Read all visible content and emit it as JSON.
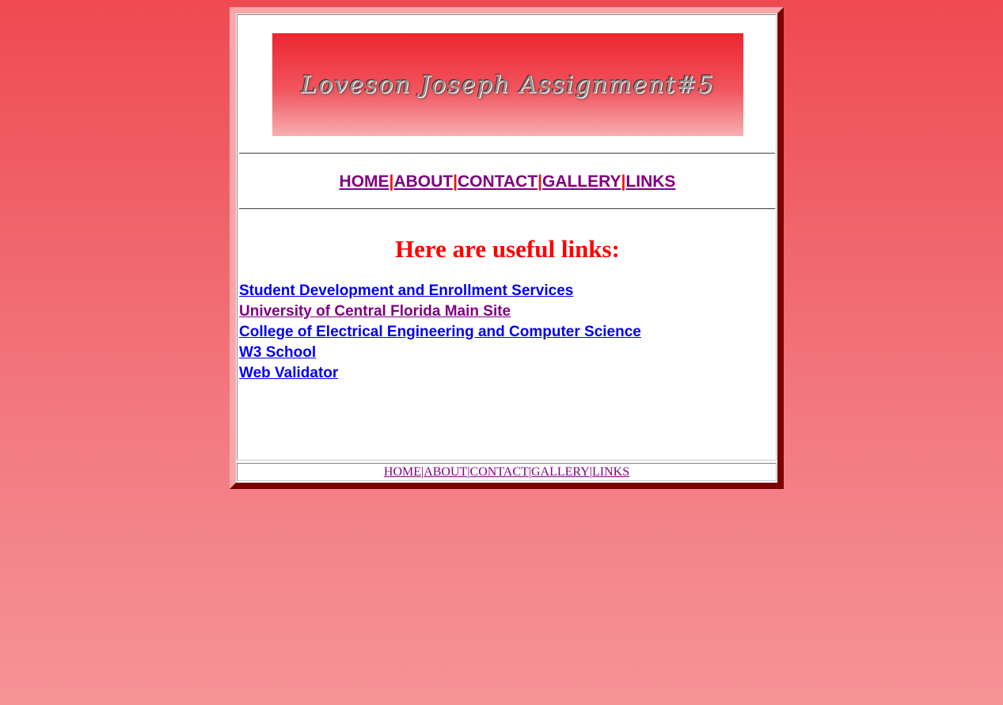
{
  "banner": {
    "title": "Loveson Joseph Assignment#5"
  },
  "nav": {
    "items": [
      "HOME",
      "ABOUT",
      "CONTACT",
      "GALLERY",
      "LINKS"
    ],
    "separator": "|",
    "link_color": "#800080",
    "separator_color": "#ee1111"
  },
  "content": {
    "heading": "Here are useful links:",
    "heading_color": "#ff0000",
    "links": [
      {
        "label": "Student Development and Enrollment Services",
        "color": "#0000ee"
      },
      {
        "label": "University of Central Florida Main Site",
        "color": "#800080"
      },
      {
        "label": "College of Electrical Engineering and Computer Science",
        "color": "#0000ee"
      },
      {
        "label": "W3 School",
        "color": "#0000ee"
      },
      {
        "label": "Web Validator",
        "color": "#0000ee"
      }
    ]
  },
  "footer": {
    "items": [
      "HOME",
      "ABOUT",
      "CONTACT",
      "GALLERY",
      "LINKS"
    ],
    "separator": "|"
  },
  "colors": {
    "background_top": "#ef4a52",
    "background_bottom": "#f59397",
    "frame_dark": "#7a0000",
    "frame_light": "#f7a6aa"
  }
}
